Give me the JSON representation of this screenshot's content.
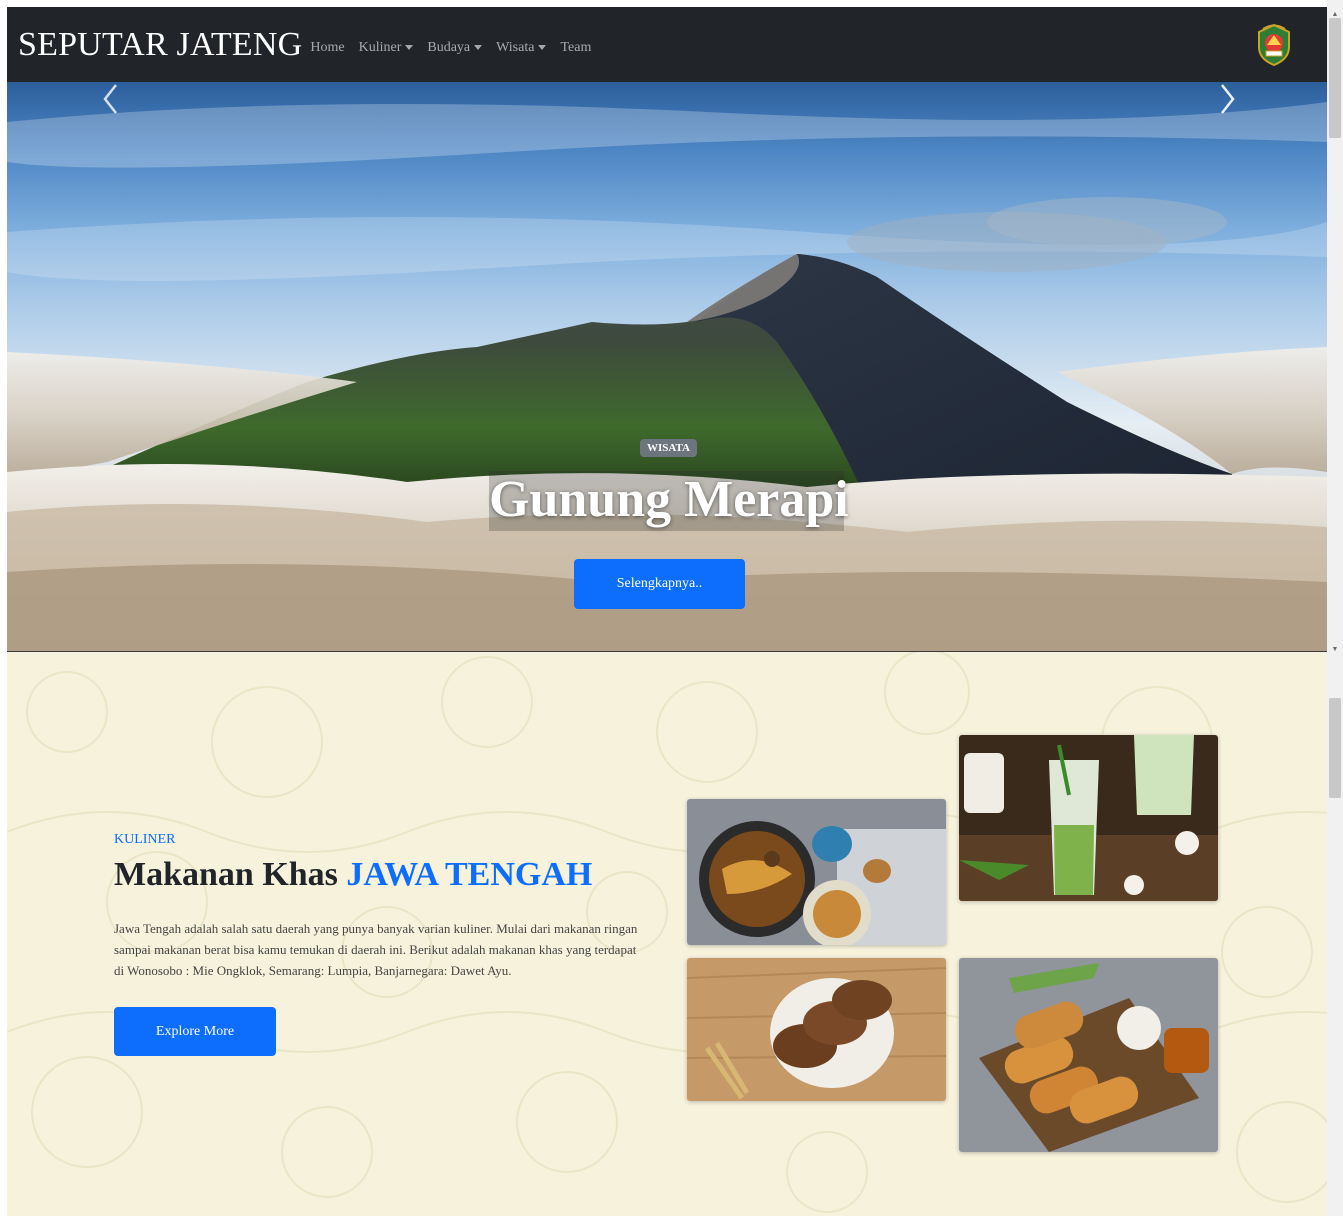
{
  "navbar": {
    "brand": "SEPUTAR JATENG",
    "items": [
      {
        "label": "Home",
        "dropdown": false
      },
      {
        "label": "Kuliner",
        "dropdown": true
      },
      {
        "label": "Budaya",
        "dropdown": true
      },
      {
        "label": "Wisata",
        "dropdown": true
      },
      {
        "label": "Team",
        "dropdown": false
      }
    ],
    "logo_icon": "jawa-tengah-emblem-icon"
  },
  "hero": {
    "badge": "WISATA",
    "title": "Gunung Merapi",
    "button_label": "Selengkapnya..",
    "prev_icon": "chevron-left-icon",
    "next_icon": "chevron-right-icon"
  },
  "kuliner": {
    "label": "KULINER",
    "title_plain": "Makanan Khas ",
    "title_accent": "JAWA TENGAH",
    "description": "Jawa Tengah adalah salah satu daerah yang punya banyak varian kuliner. Mulai dari makanan ringan sampai makanan berat bisa kamu temukan di daerah ini. Berikut adalah makanan khas yang terdapat di Wonosobo : Mie Ongklok, Semarang: Lumpia, Banjarnegara: Dawet Ayu.",
    "button_label": "Explore More"
  },
  "colors": {
    "navbar_bg": "#212529",
    "accent": "#0d6efd",
    "section_bg": "#f6f2dc",
    "badge_bg": "#6c757d"
  }
}
